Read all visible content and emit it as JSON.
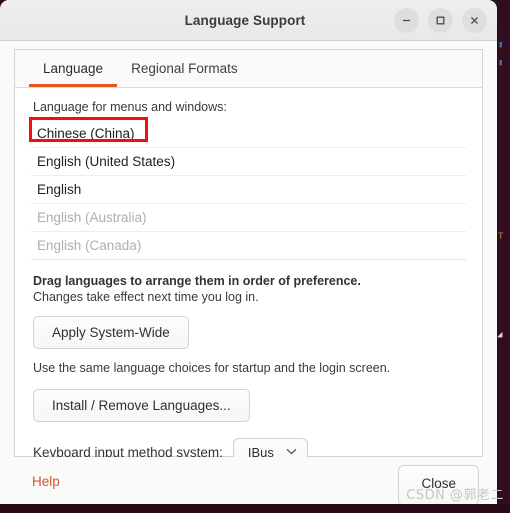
{
  "window": {
    "title": "Language Support",
    "controls": {
      "minimize": "minimize-icon",
      "maximize": "maximize-icon",
      "close": "close-icon"
    }
  },
  "tabs": [
    {
      "label": "Language",
      "active": true
    },
    {
      "label": "Regional Formats",
      "active": false
    }
  ],
  "language_panel": {
    "section_label": "Language for menus and windows:",
    "languages": [
      {
        "name": "Chinese (China)",
        "enabled": true,
        "highlighted": true
      },
      {
        "name": "English (United States)",
        "enabled": true,
        "highlighted": false
      },
      {
        "name": "English",
        "enabled": true,
        "highlighted": false
      },
      {
        "name": "English (Australia)",
        "enabled": false,
        "highlighted": false
      },
      {
        "name": "English (Canada)",
        "enabled": false,
        "highlighted": false
      }
    ],
    "drag_hint": "Drag languages to arrange them in order of preference.",
    "changes_hint": "Changes take effect next time you log in.",
    "apply_button": "Apply System-Wide",
    "apply_note": "Use the same language choices for startup and the login screen.",
    "install_button": "Install / Remove Languages...",
    "input_method_label": "Keyboard input method system:",
    "input_method_value": "IBus"
  },
  "footer": {
    "help_label": "Help",
    "close_label": "Close"
  },
  "watermark": "CSDN @郭老二",
  "colors": {
    "accent_orange": "#e8561f",
    "help_orange": "#d9532a",
    "highlight_red": "#f20e0e",
    "titlebar_bg": "#efeeed",
    "window_bg": "#ffffff",
    "disabled_text": "#b0aeac"
  }
}
